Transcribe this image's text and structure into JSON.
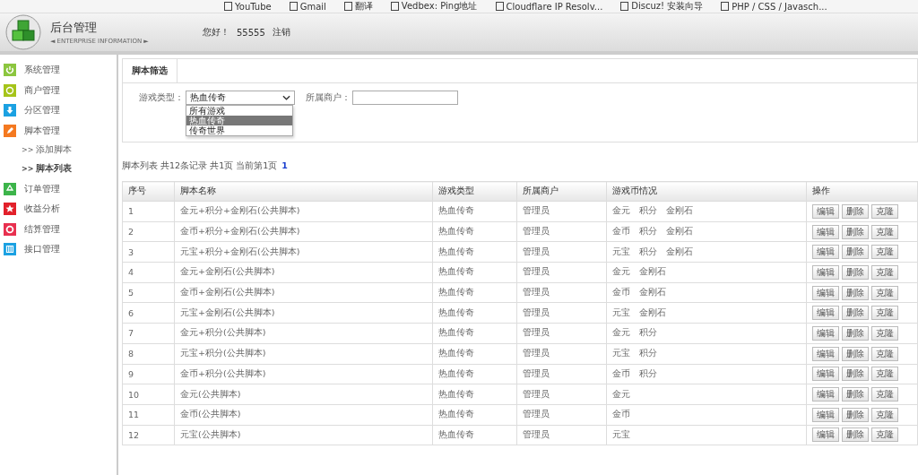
{
  "bookmarks": [
    "YouTube",
    "Gmail",
    "翻译",
    "Vedbex: Ping地址",
    "Cloudflare IP Resolv...",
    "Discuz! 安装向导",
    "PHP / CSS / Javasch..."
  ],
  "header": {
    "title": "后台管理",
    "subtitle": "◄ ENTERPRISE INFORMATION ►",
    "greeting": "您好！",
    "user": "55555",
    "logout": "注销"
  },
  "sidebar": {
    "items": [
      {
        "label": "系统管理",
        "color": "#8cc63f",
        "selected": false
      },
      {
        "label": "商户管理",
        "color": "#a5c41a",
        "selected": false
      },
      {
        "label": "分区管理",
        "color": "#1ba1e2",
        "selected": false
      },
      {
        "label": "脚本管理",
        "color": "#f47920",
        "selected": false,
        "children": [
          {
            "bullet": ">>",
            "label": "添加脚本",
            "selected": false
          },
          {
            "bullet": ">>",
            "label": "脚本列表",
            "selected": true
          }
        ]
      },
      {
        "label": "订单管理",
        "color": "#3cb44a",
        "selected": false
      },
      {
        "label": "收益分析",
        "color": "#e2202a",
        "selected": false
      },
      {
        "label": "结算管理",
        "color": "#e8304f",
        "selected": false
      },
      {
        "label": "接口管理",
        "color": "#1ba1e2",
        "selected": false
      }
    ]
  },
  "filter": {
    "tab": "脚本筛选",
    "game_type": {
      "label": "游戏类型：",
      "value": "热血传奇",
      "expanded": true,
      "options": [
        {
          "label": "所有游戏",
          "selected": false
        },
        {
          "label": "热血传奇",
          "selected": true
        },
        {
          "label": "传奇世界",
          "selected": false
        }
      ]
    },
    "merchant": {
      "label": "所属商户："
    }
  },
  "pagination": {
    "summary": "脚本列表 共12条记录 共1页 当前第1页",
    "pages": [
      {
        "label": "1",
        "selected": true
      }
    ]
  },
  "table": {
    "columns": [
      "序号",
      "脚本名称",
      "游戏类型",
      "所属商户",
      "游戏币情况",
      "操作"
    ],
    "rows": [
      {
        "cells": [
          "1",
          "金元+积分+金刚石(公共脚本)",
          "热血传奇",
          "管理员",
          "金元　积分　金刚石"
        ],
        "actions": [
          "编辑",
          "删除",
          "克隆"
        ]
      },
      {
        "cells": [
          "2",
          "金币+积分+金刚石(公共脚本)",
          "热血传奇",
          "管理员",
          "金币　积分　金刚石"
        ],
        "actions": [
          "编辑",
          "删除",
          "克隆"
        ]
      },
      {
        "cells": [
          "3",
          "元宝+积分+金刚石(公共脚本)",
          "热血传奇",
          "管理员",
          "元宝　积分　金刚石"
        ],
        "actions": [
          "编辑",
          "删除",
          "克隆"
        ]
      },
      {
        "cells": [
          "4",
          "金元+金刚石(公共脚本)",
          "热血传奇",
          "管理员",
          "金元　金刚石"
        ],
        "actions": [
          "编辑",
          "删除",
          "克隆"
        ]
      },
      {
        "cells": [
          "5",
          "金币+金刚石(公共脚本)",
          "热血传奇",
          "管理员",
          "金币　金刚石"
        ],
        "actions": [
          "编辑",
          "删除",
          "克隆"
        ]
      },
      {
        "cells": [
          "6",
          "元宝+金刚石(公共脚本)",
          "热血传奇",
          "管理员",
          "元宝　金刚石"
        ],
        "actions": [
          "编辑",
          "删除",
          "克隆"
        ]
      },
      {
        "cells": [
          "7",
          "金元+积分(公共脚本)",
          "热血传奇",
          "管理员",
          "金元　积分"
        ],
        "actions": [
          "编辑",
          "删除",
          "克隆"
        ]
      },
      {
        "cells": [
          "8",
          "元宝+积分(公共脚本)",
          "热血传奇",
          "管理员",
          "元宝　积分"
        ],
        "actions": [
          "编辑",
          "删除",
          "克隆"
        ]
      },
      {
        "cells": [
          "9",
          "金币+积分(公共脚本)",
          "热血传奇",
          "管理员",
          "金币　积分"
        ],
        "actions": [
          "编辑",
          "删除",
          "克隆"
        ]
      },
      {
        "cells": [
          "10",
          "金元(公共脚本)",
          "热血传奇",
          "管理员",
          "金元"
        ],
        "actions": [
          "编辑",
          "删除",
          "克隆"
        ]
      },
      {
        "cells": [
          "11",
          "金币(公共脚本)",
          "热血传奇",
          "管理员",
          "金币"
        ],
        "actions": [
          "编辑",
          "删除",
          "克隆"
        ]
      },
      {
        "cells": [
          "12",
          "元宝(公共脚本)",
          "热血传奇",
          "管理员",
          "元宝"
        ],
        "actions": [
          "编辑",
          "删除",
          "克隆"
        ]
      }
    ]
  }
}
